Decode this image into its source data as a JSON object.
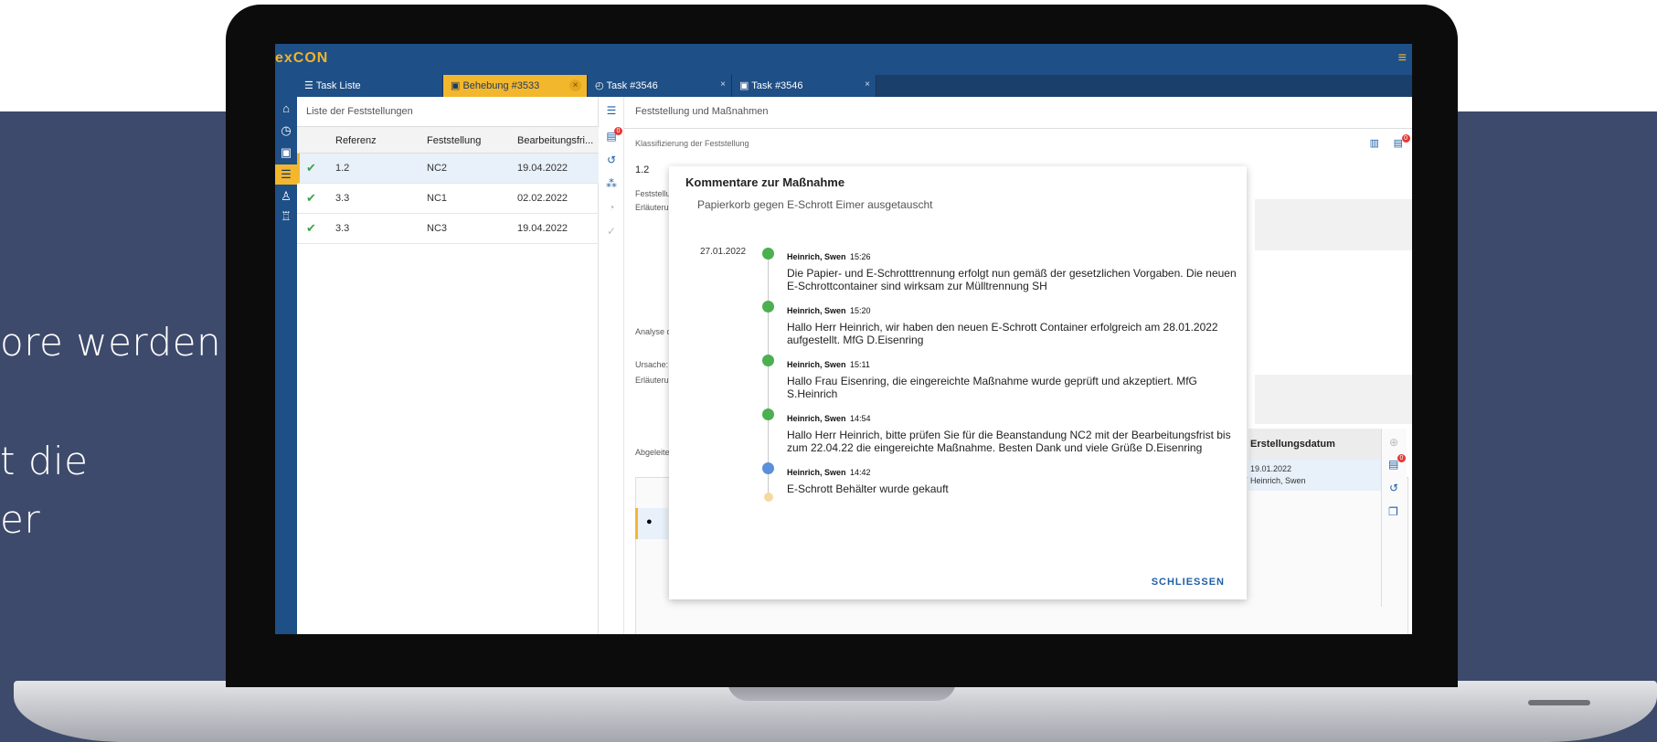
{
  "background_text": [
    "ore werden",
    "t die",
    "er"
  ],
  "app": {
    "logo": "exCON",
    "hamburger_icon": "menu-icon"
  },
  "tabs": [
    {
      "label": "Task Liste",
      "icon": "list-icon"
    },
    {
      "label": "Behebung #3533",
      "icon": "calendar-icon",
      "close": "×"
    },
    {
      "label": "Task #3546",
      "icon": "clock-icon",
      "close": "×"
    },
    {
      "label": "Task #3546",
      "icon": "calendar-icon",
      "close": "×"
    }
  ],
  "list": {
    "title": "Liste der Feststellungen",
    "headers": {
      "ref": "Referenz",
      "feststellung": "Feststellung",
      "frist": "Bearbeitungsfri..."
    },
    "rows": [
      {
        "ref": "1.2",
        "feststellung": "NC2",
        "frist": "19.04.2022"
      },
      {
        "ref": "3.3",
        "feststellung": "NC1",
        "frist": "02.02.2022"
      },
      {
        "ref": "3.3",
        "feststellung": "NC3",
        "frist": "19.04.2022"
      }
    ]
  },
  "detail": {
    "title": "Feststellung und Maßnahmen",
    "section": "Klassifizierung der Feststellung",
    "ref": "1.2",
    "labels": {
      "feststellung": "Feststellu",
      "erlaeuterung1": "Erläuterur",
      "analyse": "Analyse d",
      "ursache": "Ursache:",
      "erlaeuterung2": "Erläuterur",
      "abgeleitet": "Abgeleite"
    },
    "table_header": "Erstellungsdatum",
    "table_row": {
      "date": "19.01.2022",
      "author": "Heinrich, Swen"
    }
  },
  "modal": {
    "title": "Kommentare zur Maßnahme",
    "subtitle": "Papierkorb gegen E-Schrott Eimer ausgetauscht",
    "date": "27.01.2022",
    "entries": [
      {
        "author": "Heinrich, Swen",
        "time": "15:26",
        "text": "Die Papier- und E-Schrotttrennung erfolgt nun gemäß der gesetzlichen Vorgaben. Die neuen E-Schrottcontainer sind wirksam zur Mülltrennung SH"
      },
      {
        "author": "Heinrich, Swen",
        "time": "15:20",
        "text": "Hallo Herr Heinrich, wir haben den neuen E-Schrott Container erfolgreich am 28.01.2022 aufgestellt. MfG D.Eisenring"
      },
      {
        "author": "Heinrich, Swen",
        "time": "15:11",
        "text": "Hallo Frau Eisenring, die eingereichte Maßnahme wurde geprüft und akzeptiert. MfG S.Heinrich"
      },
      {
        "author": "Heinrich, Swen",
        "time": "14:54",
        "text": "Hallo Herr Heinrich, bitte prüfen Sie für die Beanstandung NC2 mit der Bearbeitungsfrist bis zum 22.04.22 die eingereichte Maßnahme. Besten Dank und viele Grüße D.Eisenring"
      },
      {
        "author": "Heinrich, Swen",
        "time": "14:42",
        "text": "E-Schrott Behälter wurde gekauft"
      }
    ],
    "close_label": "SCHLIESSEN"
  },
  "badges": {
    "tool_badge": "0",
    "detail_badge": "0",
    "table_badge": "0"
  },
  "colors": {
    "brand": "#1e4f86",
    "accent": "#f3b72e",
    "background": "#3e4a6b"
  }
}
